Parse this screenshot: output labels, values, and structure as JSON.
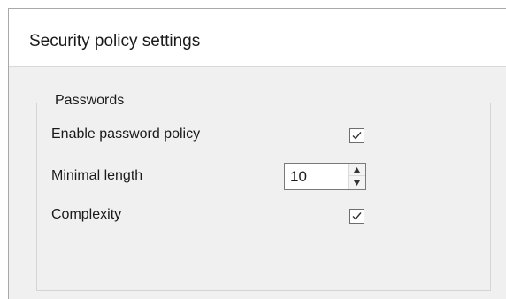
{
  "dialog": {
    "title": "Security policy settings"
  },
  "passwords_group": {
    "legend": "Passwords",
    "enable_policy": {
      "label": "Enable password policy",
      "checked": true
    },
    "minimal_length": {
      "label": "Minimal length",
      "value": "10"
    },
    "complexity": {
      "label": "Complexity",
      "checked": true
    }
  },
  "icons": {
    "check": "check-icon",
    "spin_up": "spin-up-arrow-icon",
    "spin_down": "spin-down-arrow-icon"
  }
}
